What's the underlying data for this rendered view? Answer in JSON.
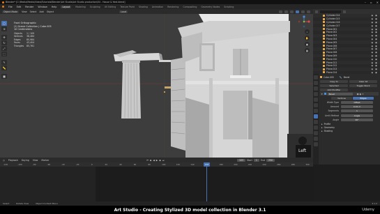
{
  "window": {
    "title": "Blender* [C:\\Media\\Media\\Video\\Tutorials\\Blender\\Art Studio\\Art Studio production\\04 - House & Yard.blend]"
  },
  "menubar": {
    "menus": [
      "File",
      "Edit",
      "Render",
      "Window",
      "Help"
    ],
    "workspaces": [
      "Layout",
      "Modeling",
      "Sculpting",
      "UV Editing",
      "Texture Paint",
      "Shading",
      "Animation",
      "Rendering",
      "Compositing",
      "Geometry Nodes",
      "Scripting"
    ],
    "active_workspace": "Layout"
  },
  "viewport_header": {
    "mode": "Object Mode",
    "menus": [
      "View",
      "Select",
      "Add",
      "Object"
    ],
    "orientation": "Local"
  },
  "viewport": {
    "view_name": "Front Orthographic",
    "collection": "(1) Scene Collection | Cube.005",
    "units": "10 Centimeters",
    "stats": [
      {
        "k": "Objects",
        "v": "1 / 109"
      },
      {
        "k": "Vertices",
        "v": "38,484"
      },
      {
        "k": "Edges",
        "v": "80,984"
      },
      {
        "k": "Faces",
        "v": "43,404"
      },
      {
        "k": "Triangles",
        "v": "85,761"
      }
    ],
    "background_color": "#3d3d3d",
    "webcam_label": "Left"
  },
  "toolbar": {
    "tools": [
      "cursor",
      "select-box",
      "move",
      "rotate",
      "scale",
      "transform",
      "annotate",
      "measure",
      "add-cube"
    ]
  },
  "outliner": {
    "items": [
      "Cylinder.014",
      "Cylinder.015",
      "Cylinder.016",
      "Cylinder.017",
      "Plane.001",
      "Plane.002",
      "Plane.003",
      "Plane.004",
      "Plane.005",
      "Plane.006",
      "Plane.007",
      "Plane.008",
      "Plane.009",
      "Plane.010",
      "Plane.011",
      "Plane.012",
      "Plane.013",
      "Plane.014"
    ]
  },
  "properties": {
    "object_name": "Cube.005",
    "modifier_label": "Bevel",
    "copy_to_label": "Copy to",
    "selected_label": "Selected",
    "clear_label": "Clear All",
    "toggle_label": "Toggle Stack",
    "add_modifier": "Add Modifier",
    "tabs": [
      "Vertices",
      "Edges"
    ],
    "active_tab": "Edges",
    "fields": [
      {
        "label": "Width Type",
        "value": "Offset"
      },
      {
        "label": "Amount",
        "value": "0.01 m"
      },
      {
        "label": "Segments",
        "value": "1"
      }
    ],
    "limit_method": {
      "label": "Limit Method",
      "value": "Angle"
    },
    "angle": {
      "label": "Angle",
      "value": "30°"
    },
    "sections": [
      "Profile",
      "Geometry",
      "Shading"
    ]
  },
  "timeline": {
    "menus": [
      "Playback",
      "Keying",
      "View",
      "Marker"
    ],
    "current_frame": "103",
    "start": "1",
    "end": "250",
    "start_label": "Start",
    "end_label": "End",
    "ruler_ticks": [
      "-120",
      "-100",
      "-80",
      "-60",
      "-40",
      "-20",
      "0",
      "20",
      "40",
      "60",
      "80",
      "100",
      "120",
      "140",
      "160",
      "180",
      "200",
      "220",
      "240",
      "260",
      "280",
      "300"
    ]
  },
  "statusbar": {
    "items": [
      "Select",
      "Rotate View",
      "Object Context Menu"
    ],
    "version": "3.1.2"
  },
  "caption": {
    "text": "Art Studio - Creating Stylized 3D model collection in Blender 3.1",
    "brand": "Udemy"
  }
}
